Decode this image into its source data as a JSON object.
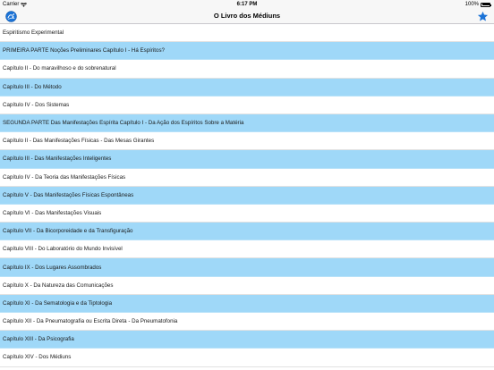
{
  "status_bar": {
    "carrier": "Carrier",
    "time": "6:17 PM",
    "battery": "100%"
  },
  "nav": {
    "title": "O Livro dos Médiuns",
    "left_icon": "app-logo-icon",
    "right_icon": "star-icon"
  },
  "colors": {
    "alt_row": "#9fd8f8",
    "accent": "#1a72d6"
  },
  "chapters": [
    "Espiritismo Experimental",
    "PRIMEIRA PARTE Noções Preliminares Capítulo I - Há Espíritos?",
    "Capítulo II - Do maravilhoso e do sobrenatural",
    "Capítulo III - Do Método",
    "Capítulo IV - Dos Sistemas",
    "SEGUNDA PARTE Das Manifestações Espírita Capítulo I - Da Ação dos Espíritos Sobre a Matéria",
    "Capítulo II - Das Manifestações Físicas - Das Mesas Girantes",
    "Capítulo III - Das Manifestações Inteligentes",
    "Capítulo IV - Da Teoria das Manifestações Físicas",
    "Capítulo V - Das Manifestações Físicas Espontâneas",
    "Capítulo VI - Das Manifestações Visuais",
    "Capítulo VII - Da Bicorporeidade e da Transfiguração",
    "Capítulo VIII - Do Laboratório do Mundo Invisível",
    "Capítulo IX - Dos Lugares Assombrados",
    "Capítulo X - Da Natureza das Comunicações",
    "Capítulo XI - Da Sematologia e da Tiptologia",
    "Capítulo XII - Da Pneumatografia ou Escrita Direta - Da Pneumatofonia",
    "Capítulo XIII - Da Psicografia",
    "Capítulo XIV - Dos Médiuns"
  ]
}
